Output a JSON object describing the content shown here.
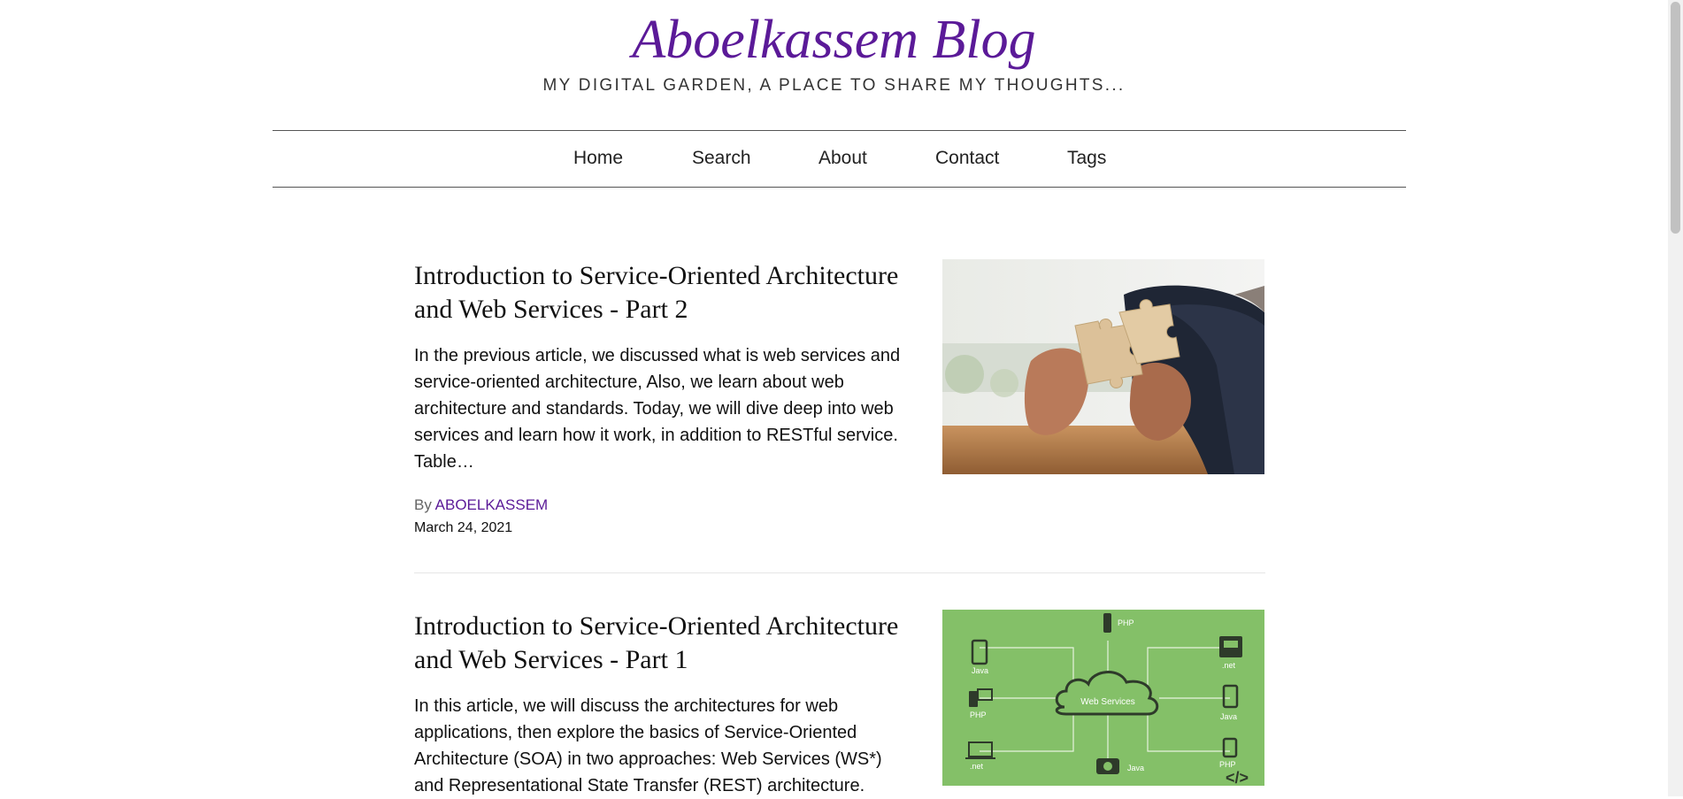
{
  "site": {
    "title": "Aboelkassem Blog",
    "tagline": "MY DIGITAL GARDEN, A PLACE TO SHARE MY THOUGHTS..."
  },
  "nav": {
    "items": [
      {
        "label": "Home"
      },
      {
        "label": "Search"
      },
      {
        "label": "About"
      },
      {
        "label": "Contact"
      },
      {
        "label": "Tags"
      }
    ]
  },
  "posts": [
    {
      "title": "Introduction to Service-Oriented Architecture and Web Services - Part 2",
      "excerpt": "In the previous article, we discussed what is web services and service-oriented architecture, Also, we learn about web architecture and standards. Today, we will dive deep into web services and learn how it work, in addition to RESTful service. Table…",
      "by_label": "By",
      "author": "ABOELKASSEM",
      "date": "March 24, 2021"
    },
    {
      "title": "Introduction to Service-Oriented Architecture and Web Services - Part 1",
      "excerpt": "In this article, we will discuss the architectures for web applications, then explore the basics of Service-Oriented Architecture (SOA) in two approaches: Web Services (WS*) and Representational State Transfer (REST) architecture.",
      "image_labels": {
        "center": "Web Services",
        "top": "PHP",
        "left_top": "Java",
        "left_mid": "PHP",
        "left_bottom": ".net",
        "right_top": ".net",
        "right_mid": "Java",
        "right_bottom": "PHP",
        "bottom": "Java"
      }
    }
  ],
  "colors": {
    "brand": "#5b1a98",
    "thumb_green": "#84c068"
  }
}
